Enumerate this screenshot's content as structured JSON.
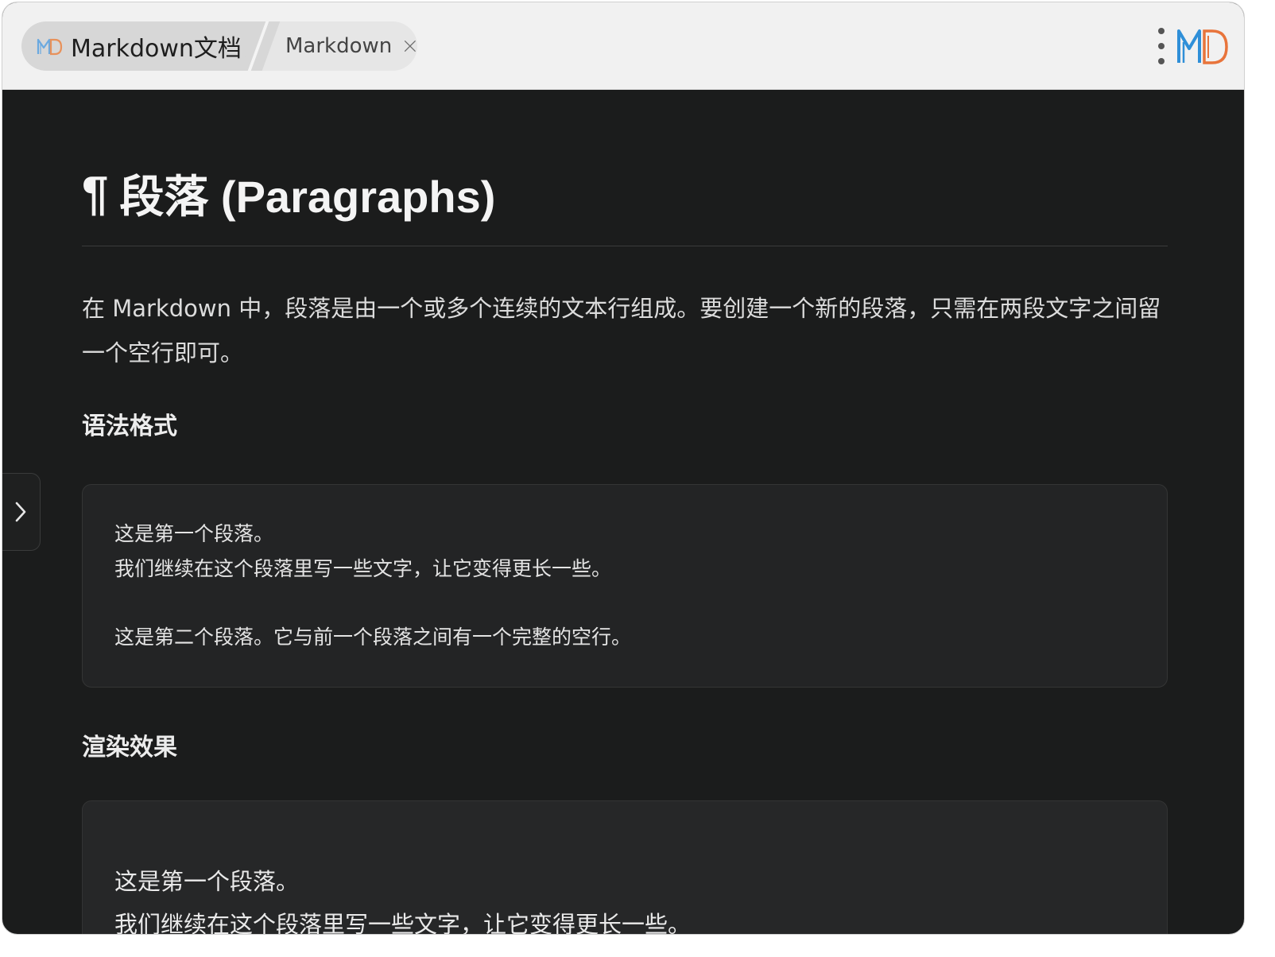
{
  "titlebar": {
    "tabs": [
      {
        "label": "Markdown文档",
        "active": true,
        "icon": "md-logo-icon"
      },
      {
        "label": "Markdown",
        "active": false,
        "close_icon": "close-icon"
      }
    ],
    "menu_icon": "more-vertical-icon",
    "app_logo": "md-logo-icon"
  },
  "sidebar": {
    "toggle_icon": "chevron-right-icon"
  },
  "document": {
    "pilcrow": "¶",
    "title": "段落 (Paragraphs)",
    "intro": "在 Markdown 中，段落是由一个或多个连续的文本行组成。要创建一个新的段落，只需在两段文字之间留一个空行即可。",
    "syntax_heading": "语法格式",
    "code_lines": [
      "这是第一个段落。",
      "我们继续在这个段落里写一些文字，让它变得更长一些。",
      "",
      "这是第二个段落。它与前一个段落之间有一个完整的空行。"
    ],
    "render_heading": "渲染效果",
    "render_lines": [
      "这是第一个段落。",
      "我们继续在这个段落里写一些文字，让它变得更长一些。"
    ]
  },
  "colors": {
    "background": "#1b1c1c",
    "titlebar": "#f1f1f1",
    "logo_blue": "#2f8fd8",
    "logo_orange": "#e8743b"
  }
}
